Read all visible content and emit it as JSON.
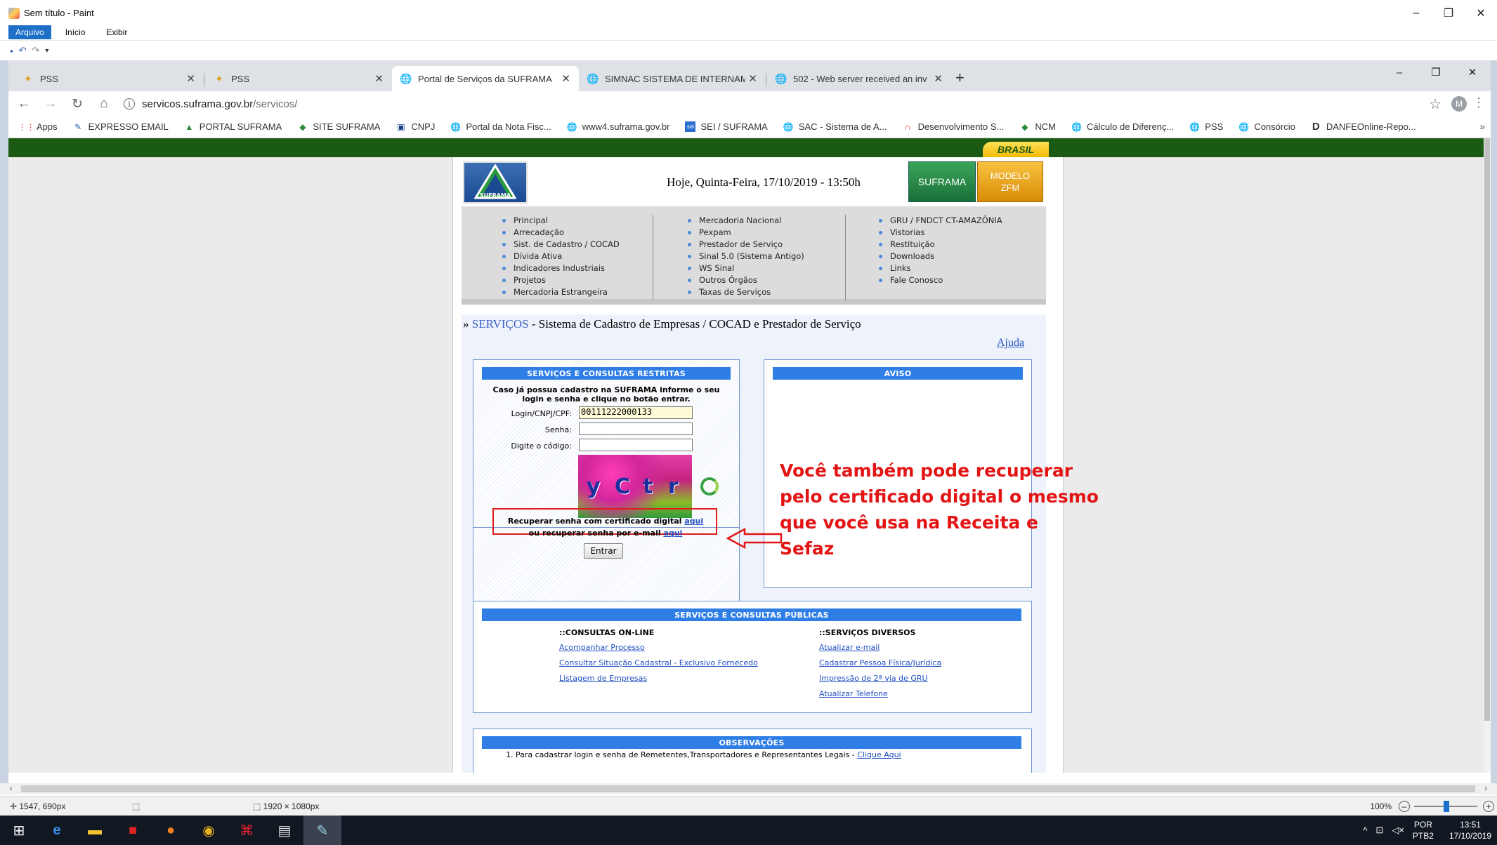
{
  "paint": {
    "title": "Sem título - Paint",
    "menu": [
      "Arquivo",
      "Início",
      "Exibir"
    ],
    "window_buttons": [
      "–",
      "❐",
      "✕"
    ],
    "status_position": "1547, 690px",
    "status_size": "1920 × 1080px",
    "zoom": "100%"
  },
  "browser": {
    "tabs": [
      {
        "label": "PSS",
        "active": false
      },
      {
        "label": "PSS",
        "active": false
      },
      {
        "label": "Portal de Serviços da SUFRAMA",
        "active": true
      },
      {
        "label": "SIMNAC SISTEMA DE INTERNAM",
        "active": false
      },
      {
        "label": "502 - Web server received an inv",
        "active": false
      }
    ],
    "url_host": "servicos.suframa.gov.br",
    "url_path": "/servicos/",
    "profile_initial": "M",
    "bookmarks": [
      "Apps",
      "EXPRESSO EMAIL",
      "PORTAL SUFRAMA",
      "SITE SUFRAMA",
      "CNPJ",
      "Portal da Nota Fisc...",
      "www4.suframa.gov.br",
      "SEI / SUFRAMA",
      "SAC - Sistema de A...",
      "Desenvolvimento S...",
      "NCM",
      "Cálculo de Diferenç...",
      "PSS",
      "Consórcio",
      "DANFEOnline-Repo..."
    ]
  },
  "site": {
    "brasil_badge": "BRASIL",
    "logo_text": "SUFRAMA",
    "date_text": "Hoje, Quinta-Feira, 17/10/2019 - 13:50h",
    "btn_suframa": "SUFRAMA",
    "btn_zfm_line1": "MODELO",
    "btn_zfm_line2": "ZFM",
    "nav_col1": [
      "Principal",
      "Arrecadação",
      "Sist. de Cadastro / COCAD",
      "Dívida Ativa",
      "Indicadores Industriais",
      "Projetos",
      "Mercadoria Estrangeira"
    ],
    "nav_col2": [
      "Mercadoria Nacional",
      "Pexpam",
      "Prestador de Serviço",
      "Sinal 5.0 (Sistema Antigo)",
      "WS Sinal",
      "Outros Órgãos",
      "Taxas de Serviços"
    ],
    "nav_col3": [
      "GRU / FNDCT CT-AMAZÔNIA",
      "Vistorias",
      "Restituição",
      "Downloads",
      "Links",
      "Fale Conosco"
    ],
    "breadcrumb_prefix": "» ",
    "breadcrumb_link": "SERVIÇOS",
    "breadcrumb_rest": " - Sistema de Cadastro de Empresas / COCAD e Prestador de Serviço",
    "help_link": "Ajuda",
    "restricted": {
      "header": "SERVIÇOS E CONSULTAS RESTRITAS",
      "intro": "Caso já possua cadastro na SUFRAMA informe o seu login e senha e clique no botão entrar.",
      "login_label": "Login/CNPJ/CPF:",
      "login_value": "00111222000133",
      "password_label": "Senha:",
      "code_label": "Digite o código:",
      "captcha_chars": [
        "y",
        "C",
        "t",
        "r"
      ],
      "recover_cert_text": "Recuperar senha com certificado digital ",
      "recover_cert_link": "aqui",
      "recover_email_text": "ou recuperar senha por e-mail ",
      "recover_email_link": "aqui",
      "enter_button": "Entrar"
    },
    "notice": {
      "header": "AVISO"
    },
    "public": {
      "header": "SERVIÇOS E CONSULTAS PÚBLICAS",
      "col1_title": "::CONSULTAS ON-LINE",
      "col1_links": [
        "Acompanhar Processo",
        "Consultar Situação Cadastral - Exclusivo Fornecedo",
        "Listagem de Empresas"
      ],
      "col2_title": "::SERVIÇOS DIVERSOS",
      "col2_links": [
        "Atualizar e-mail",
        "Cadastrar Pessoa Física/Jurídica",
        "Impressão de 2ª via de GRU",
        "Atualizar Telefone"
      ]
    },
    "observations": {
      "header": "OBSERVAÇÕES",
      "item1_text": "1. Para cadastrar login e senha de Remetentes,Transportadores e Representantes Legais - ",
      "item1_link": "Clique Aqui"
    }
  },
  "annotation": {
    "lines": [
      "Você também pode recuperar",
      "pelo certificado digital o mesmo",
      "que você usa na Receita e",
      "Sefaz"
    ],
    "color": "#e31414"
  },
  "taskbar": {
    "lang_1": "POR",
    "lang_2": "PTB2",
    "time": "13:51",
    "date": "17/10/2019"
  }
}
